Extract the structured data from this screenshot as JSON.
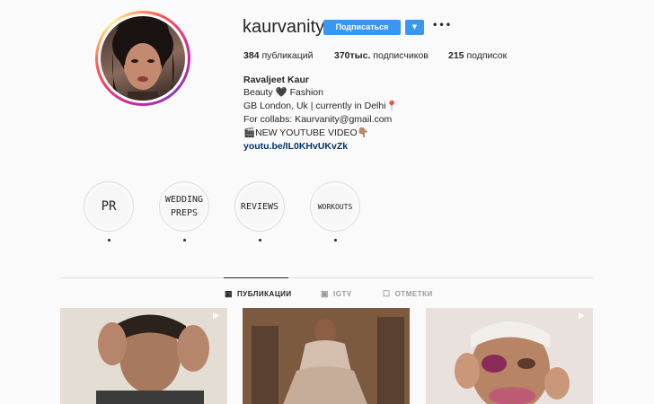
{
  "profile": {
    "username": "kaurvanity",
    "follow_label": "Подписаться",
    "dropdown_icon": "▼",
    "more_icon": "•••"
  },
  "stats": {
    "posts_count": "384",
    "posts_label": "публикаций",
    "followers_count": "370тыс.",
    "followers_label": "подписчиков",
    "following_count": "215",
    "following_label": "подписок"
  },
  "bio": {
    "name": "Ravaljeet Kaur",
    "line1": "Beauty 🖤 Fashion",
    "line2": "GB London, Uk | currently in Delhi📍",
    "line3": "For collabs: Kaurvanity@gmail.com",
    "line4": "🎬NEW YOUTUBE VIDEO👇🏽",
    "link": "youtu.be/IL0KHvUKvZk"
  },
  "highlights": [
    {
      "label": "PR"
    },
    {
      "label": "WEDDING PREPS"
    },
    {
      "label": "REVIEWS"
    },
    {
      "label": "WORKOUTS"
    }
  ],
  "tabs": [
    {
      "label": "ПУБЛИКАЦИИ",
      "icon": "grid-icon",
      "active": true
    },
    {
      "label": "IGTV",
      "icon": "igtv-icon",
      "active": false
    },
    {
      "label": "ОТМЕТКИ",
      "icon": "tag-icon",
      "active": false
    }
  ],
  "colors": {
    "accent": "#3897f0",
    "link": "#003569",
    "divider": "#dbdbdb"
  }
}
